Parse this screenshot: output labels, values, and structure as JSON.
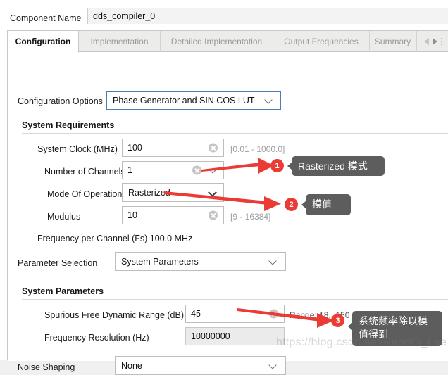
{
  "window": {
    "component_name_label": "Component Name",
    "component_name_value": "dds_compiler_0"
  },
  "tabs": [
    {
      "label": "Configuration",
      "active": true
    },
    {
      "label": "Implementation",
      "active": false
    },
    {
      "label": "Detailed Implementation",
      "active": false
    },
    {
      "label": "Output Frequencies",
      "active": false
    },
    {
      "label": "Summary",
      "active": false
    }
  ],
  "tab_nav": {
    "prev_icon": "triangle-left-icon",
    "next_icon": "triangle-right-icon",
    "more_icon": "kebab-dots-icon"
  },
  "config_options": {
    "label": "Configuration Options",
    "value": "Phase Generator and SIN COS LUT",
    "focused": true,
    "chevron_icon": "chevron-down-icon"
  },
  "system_requirements": {
    "title": "System Requirements",
    "fields": [
      {
        "label": "System Clock (MHz)",
        "value": "100",
        "hint": "[0.01 - 1000.0]",
        "type": "text",
        "clear_icon": "clear-circle-icon"
      },
      {
        "label": "Number of Channels",
        "value": "1",
        "hint": "",
        "type": "text-combo",
        "clear_icon": "clear-circle-icon",
        "chevron_icon": "chevron-down-icon"
      },
      {
        "label": "Mode Of Operation",
        "value": "Rasterized",
        "hint": "",
        "type": "combo",
        "chevron_icon": "chevron-down-icon"
      },
      {
        "label": "Modulus",
        "value": "10",
        "hint": "[9 - 16384]",
        "type": "text",
        "clear_icon": "clear-circle-icon"
      }
    ],
    "note": "Frequency per Channel (Fs) 100.0 MHz"
  },
  "parameter_selection": {
    "label": "Parameter Selection",
    "value": "System Parameters",
    "chevron_icon": "chevron-down-icon"
  },
  "system_parameters": {
    "title": "System Parameters",
    "fields": [
      {
        "label": "Spurious Free Dynamic Range (dB)",
        "value": "45",
        "hint": "Range: 18...150",
        "type": "text",
        "clear_icon": "clear-circle-icon"
      },
      {
        "label": "Frequency Resolution (Hz)",
        "value": "10000000",
        "hint": "",
        "type": "text-disabled"
      }
    ]
  },
  "noise_shaping": {
    "label": "Noise Shaping",
    "value": "None",
    "chevron_icon": "chevron-down-icon"
  },
  "annotations": {
    "accent_color": "#ea3b35",
    "callout_bg": "#5d5d5d",
    "items": [
      {
        "number": "1",
        "text": "Rasterized 模式"
      },
      {
        "number": "2",
        "text": "模值"
      },
      {
        "number": "3",
        "text": "系统频率除以模\n值得到"
      }
    ]
  },
  "watermark": {
    "text": "https://blog.csdn.net/Reborn_Lee"
  }
}
